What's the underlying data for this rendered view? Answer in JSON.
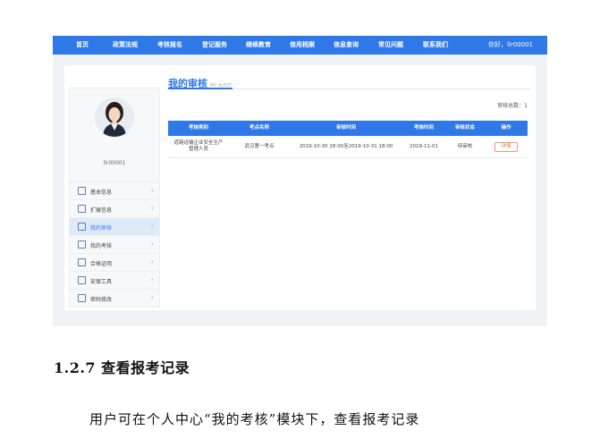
{
  "screenshot": {
    "nav": {
      "items": [
        "首页",
        "政策法规",
        "考核报名",
        "登记服务",
        "继续教育",
        "信用档案",
        "信息查询",
        "常见问题",
        "联系我们"
      ],
      "greeting": "你好，llr00001"
    },
    "sidebar": {
      "username": "llr00001",
      "menu": [
        {
          "label": "基本信息",
          "icon": "profile-icon"
        },
        {
          "label": "扩展信息",
          "icon": "document-edit-icon"
        },
        {
          "label": "我的审核",
          "icon": "audit-icon",
          "active": true
        },
        {
          "label": "我的考核",
          "icon": "user-exam-icon"
        },
        {
          "label": "合格证明",
          "icon": "certificate-icon"
        },
        {
          "label": "安保工具",
          "icon": "shield-icon"
        },
        {
          "label": "密码修改",
          "icon": "lock-icon"
        }
      ]
    },
    "content": {
      "title": "我的审核",
      "subtitle": "MY AUDIT",
      "count_text": "审核总数：1",
      "table": {
        "headers": [
          "考核类别",
          "考点名称",
          "审核时间",
          "考核时间",
          "审核状态",
          "操作"
        ],
        "rows": [
          {
            "category": "道路运输企业安全生产管理人员",
            "site": "武汉第一考点",
            "audit_time": "2019-10-30 18:00至2019-10-31 18:00",
            "exam_time": "2019-11-01",
            "status": "待审核",
            "action": "详情"
          }
        ]
      }
    },
    "colors": {
      "primary": "#2f78e8",
      "detail_button": "#e8734f"
    }
  },
  "document": {
    "heading": "1.2.7 查看报考记录",
    "paragraph": "用户可在个人中心“我的考核”模块下，查看报考记录"
  }
}
